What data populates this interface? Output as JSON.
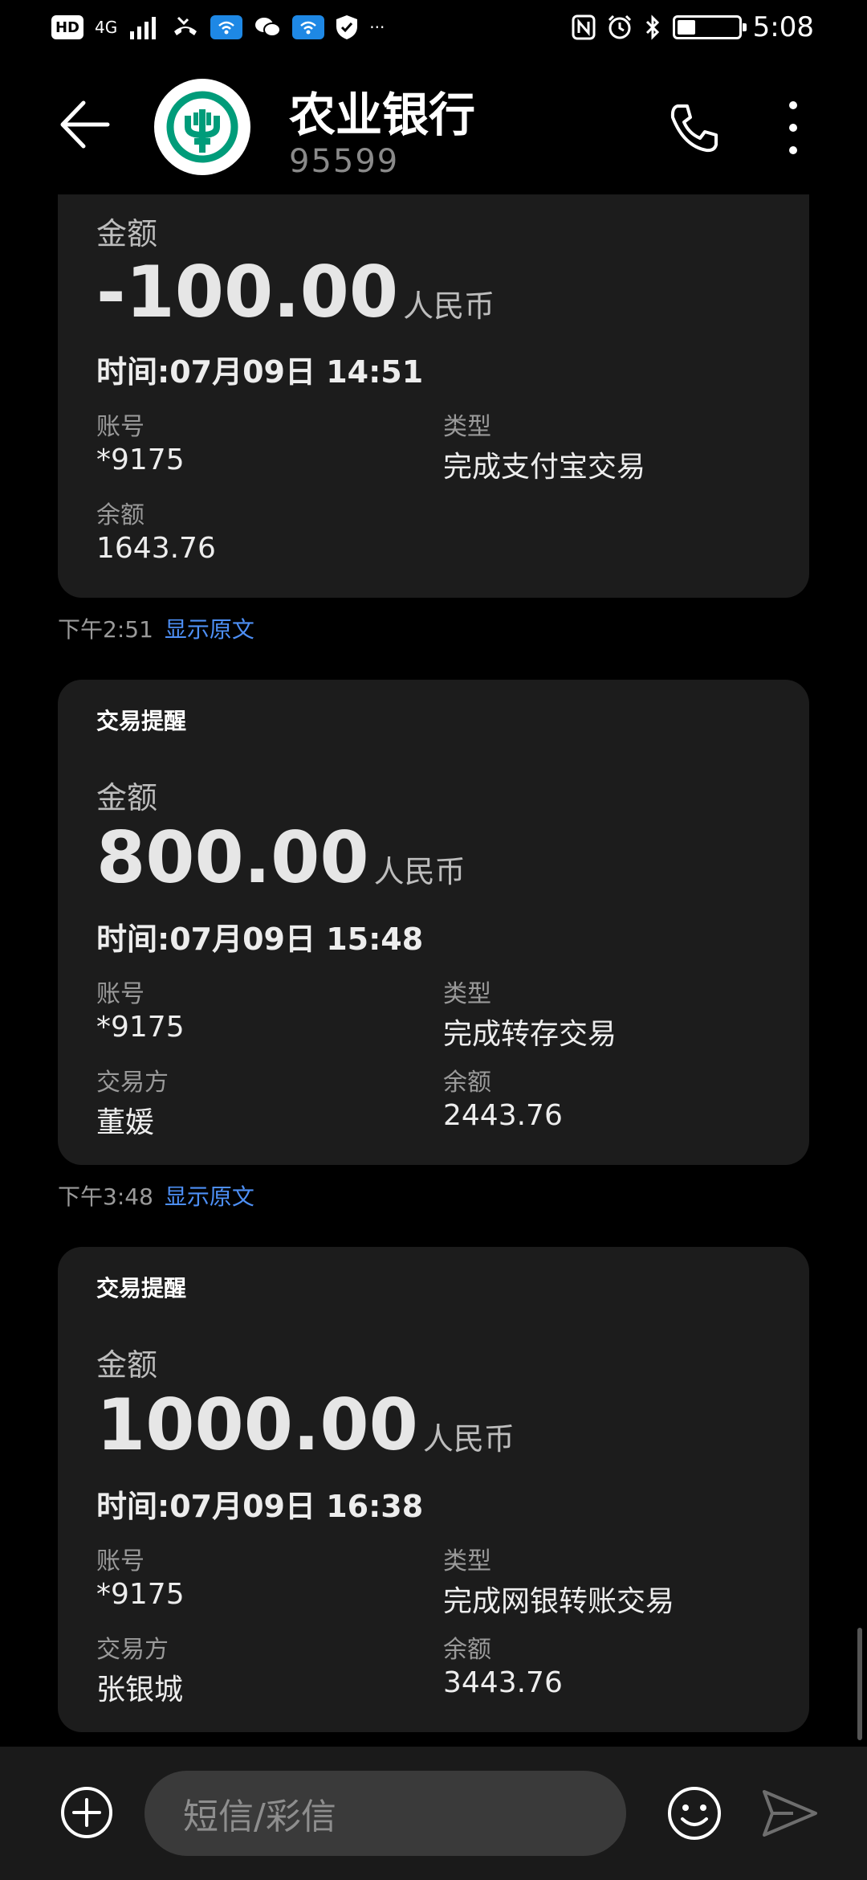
{
  "status_bar": {
    "left_icons": [
      "HD",
      "4G",
      "signal-bars",
      "missed-call",
      "wifi-app",
      "wechat",
      "wifi-app",
      "shield",
      "more"
    ],
    "hd": "HD",
    "network": "4G",
    "more": "···",
    "time": "5:08",
    "battery_percent": 30
  },
  "header": {
    "title": "农业银行",
    "number": "95599",
    "brand_color": "#009c7a"
  },
  "messages": [
    {
      "title": "",
      "amount_label": "金额",
      "amount": "-100.00",
      "currency": "人民币",
      "time": "时间:07月09日 14:51",
      "account_label": "账号",
      "account": "*9175",
      "type_label": "类型",
      "type": "完成支付宝交易",
      "extra_label": "余额",
      "extra": "1643.76",
      "meta_time": "下午2:51",
      "meta_link": "显示原文"
    },
    {
      "title": "交易提醒",
      "amount_label": "金额",
      "amount": "800.00",
      "currency": "人民币",
      "time": "时间:07月09日 15:48",
      "account_label": "账号",
      "account": "*9175",
      "type_label": "类型",
      "type": "完成转存交易",
      "party_label": "交易方",
      "party": "董媛",
      "balance_label": "余额",
      "balance": "2443.76",
      "meta_time": "下午3:48",
      "meta_link": "显示原文"
    },
    {
      "title": "交易提醒",
      "amount_label": "金额",
      "amount": "1000.00",
      "currency": "人民币",
      "time": "时间:07月09日 16:38",
      "account_label": "账号",
      "account": "*9175",
      "type_label": "类型",
      "type": "完成网银转账交易",
      "party_label": "交易方",
      "party": "张银城",
      "balance_label": "余额",
      "balance": "3443.76"
    }
  ],
  "composer": {
    "placeholder": "短信/彩信"
  },
  "colors": {
    "card_bg": "#1c1c1c",
    "link": "#4d8ff5",
    "background": "#000000"
  }
}
